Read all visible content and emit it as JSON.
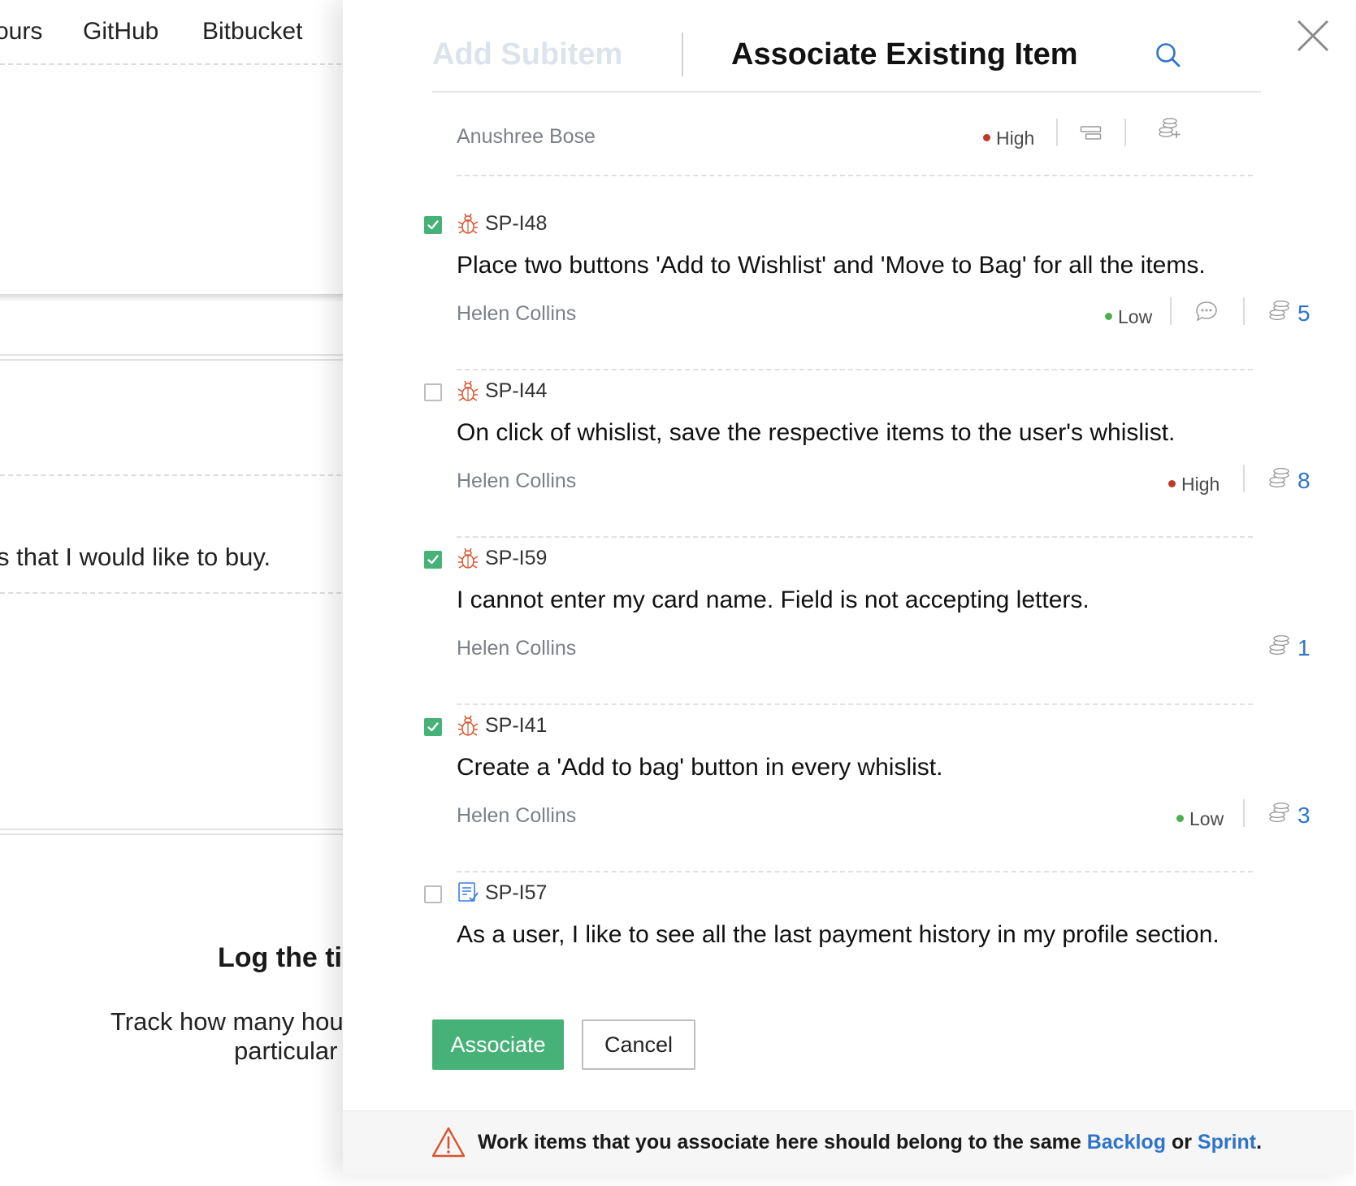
{
  "background": {
    "nav_items": [
      "ours",
      "GitHub",
      "Bitbucket"
    ],
    "story_snippet": "s that I would like to buy.",
    "log_heading": "Log the tin",
    "log_line1": "Track how many hours",
    "log_line2": "particular ’"
  },
  "panel": {
    "tabs": {
      "add_subitem": "Add Subitem",
      "associate_existing": "Associate Existing Item"
    },
    "parent": {
      "owner": "Anushree Bose",
      "priority": "High",
      "priority_color": "#c0392b"
    },
    "items": [
      {
        "id": "SP-I48",
        "type": "bug-icon",
        "checked": true,
        "title": "Place two buttons 'Add to Wishlist' and 'Move to Bag' for all the items.",
        "owner": "Helen Collins",
        "priority": "Low",
        "priority_color": "#4caf50",
        "points": "5"
      },
      {
        "id": "SP-I44",
        "type": "bug-icon",
        "checked": false,
        "title": "On click of whislist, save the respective items to the user's whislist.",
        "owner": "Helen Collins",
        "priority": "High",
        "priority_color": "#c0392b",
        "points": "8"
      },
      {
        "id": "SP-I59",
        "type": "bug-icon",
        "checked": true,
        "title": "I cannot enter my card name. Field is not accepting letters.",
        "owner": "Helen Collins",
        "points": "1"
      },
      {
        "id": "SP-I41",
        "type": "bug-icon",
        "checked": true,
        "title": "Create a 'Add to bag' button in every whislist.",
        "owner": "Helen Collins",
        "priority": "Low",
        "priority_color": "#4caf50",
        "points": "3"
      },
      {
        "id": "SP-I57",
        "type": "story-icon",
        "checked": false,
        "title": "As a user, I like to see all the last payment history in my profile section."
      }
    ],
    "buttons": {
      "associate": "Associate",
      "cancel": "Cancel"
    },
    "footer": {
      "text": "Work items that you associate here should belong to the same",
      "link_backlog": "Backlog",
      "or": "or",
      "link_sprint": "Sprint",
      "period": "."
    },
    "colors": {
      "accent_green": "#47b277",
      "link_blue": "#2f74c9",
      "bug_red": "#d9532c",
      "warning_red": "#d9532c"
    }
  }
}
